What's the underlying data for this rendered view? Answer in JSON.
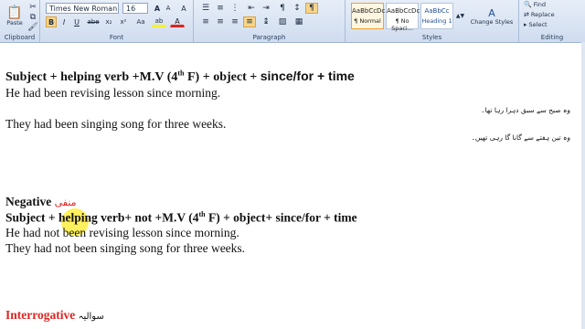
{
  "ribbon": {
    "clipboard": {
      "paste_label": "Paste",
      "group_label": "Clipboard"
    },
    "font": {
      "font_name": "Times New Roman",
      "font_size": "16",
      "bold": "B",
      "italic": "I",
      "underline": "U",
      "strike": "abe",
      "subscript": "x₂",
      "superscript": "x²",
      "grow": "A",
      "shrink": "A",
      "case": "Aa",
      "clear": "A",
      "highlight": "ab",
      "color": "A",
      "group_label": "Font"
    },
    "paragraph": {
      "group_label": "Paragraph"
    },
    "styles": {
      "tiles": [
        {
          "sample": "AaBbCcDc",
          "name": "¶ Normal"
        },
        {
          "sample": "AaBbCcDc",
          "name": "¶ No Spaci..."
        },
        {
          "sample": "AaBbCc",
          "name": "Heading 1"
        }
      ],
      "change_styles": "Change Styles",
      "group_label": "Styles"
    },
    "editing": {
      "find": "Find",
      "replace": "Replace",
      "select": "Select",
      "group_label": "Editing"
    }
  },
  "document": {
    "formula1": {
      "pre": "Subject + helping verb +M.V (4",
      "sup": "th",
      "mid": " F) + object + ",
      "tail": "since/for + time"
    },
    "ex1": "He had been revising lesson since morning.",
    "ex1_urdu": "وہ صبح سے سبق دہرا رہا تھا۔",
    "ex2": "They had been singing song for three weeks.",
    "ex2_urdu": "وہ تین ہفتے سے گانا گا رہی تھیں۔",
    "negative_heading": "Negative",
    "negative_urdu": "منفی",
    "formula2": {
      "pre": "Subject + helping verb+ not +M.V (4",
      "sup": "th",
      "post": " F) + object+ since/for + time"
    },
    "neg1": "He had not been revising lesson since morning.",
    "neg2": "They had not been singing song for three weeks.",
    "interrogative_heading": "Interrogative",
    "interrogative_urdu": "سوالیہ"
  }
}
